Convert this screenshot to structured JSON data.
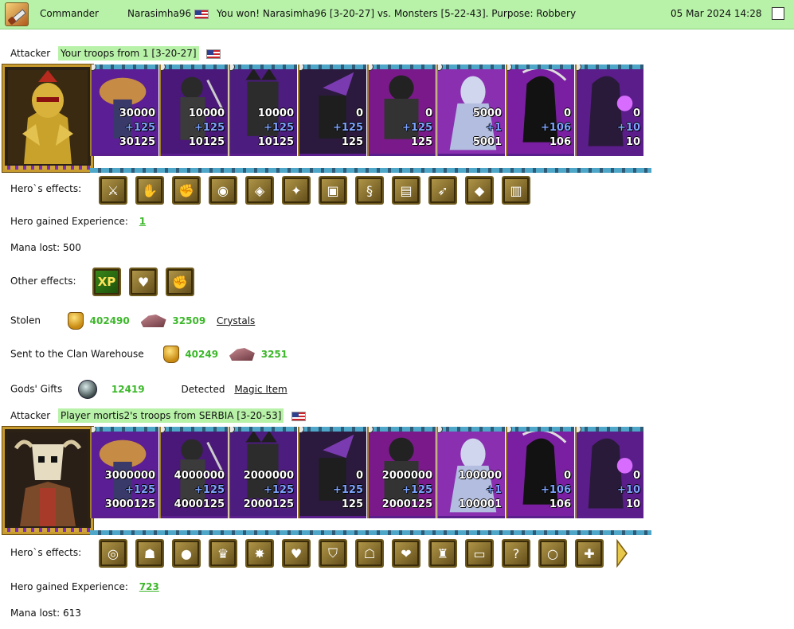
{
  "header": {
    "icon": "battle-report-icon",
    "role": "Commander",
    "player": "Narasimha96",
    "message": "You won! Narasimha96 [3-20-27] vs. Monsters [5-22-43]. Purpose: Robbery",
    "datetime": "05 Mar 2024 14:28",
    "bg_color": "#b8f2a8"
  },
  "attacker1": {
    "label": "Attacker",
    "troops": "Your troops from 1 [3-20-27]",
    "units": [
      {
        "n1": "30000",
        "n2": "+125",
        "n3": "30125"
      },
      {
        "n1": "10000",
        "n2": "+125",
        "n3": "10125"
      },
      {
        "n1": "10000",
        "n2": "+125",
        "n3": "10125"
      },
      {
        "n1": "0",
        "n2": "+125",
        "n3": "125"
      },
      {
        "n1": "0",
        "n2": "+125",
        "n3": "125"
      },
      {
        "n1": "5000",
        "n2": "+1",
        "n3": "5001"
      },
      {
        "n1": "0",
        "n2": "+106",
        "n3": "106"
      },
      {
        "n1": "0",
        "n2": "+10",
        "n3": "10"
      }
    ],
    "hero_effects_label": "Hero`s effects:",
    "hero_effects": [
      "sword-icon",
      "handshake-icon",
      "hand-icon",
      "pouch-icon",
      "shield-leaf-icon",
      "claw-icon",
      "armor-icon",
      "amulet-icon",
      "chest-icon",
      "bow-icon",
      "gem-bracer-icon",
      "vest-icon"
    ],
    "exp_label": "Hero gained Experience:",
    "exp_value": "1",
    "mana_label": "Mana lost:",
    "mana_value": "500",
    "other_effects_label": "Other effects:",
    "other_effects": [
      "XP",
      "heart-sword-icon",
      "fist-sword-icon"
    ],
    "stolen_label": "Stolen",
    "stolen_gold": "402490",
    "stolen_crystals": "32509",
    "stolen_link": "Crystals",
    "clan_label": "Sent to the Clan Warehouse",
    "clan_gold": "40249",
    "clan_crystals": "3251",
    "gods_label": "Gods' Gifts",
    "gods_value": "12419",
    "detected_label": "Detected",
    "detected_link": "Magic Item"
  },
  "attacker2": {
    "label": "Attacker",
    "troops": "Player mortis2's troops from SERBIA [3-20-53]",
    "units": [
      {
        "n1": "3000000",
        "n2": "+125",
        "n3": "3000125"
      },
      {
        "n1": "4000000",
        "n2": "+125",
        "n3": "4000125"
      },
      {
        "n1": "2000000",
        "n2": "+125",
        "n3": "2000125"
      },
      {
        "n1": "0",
        "n2": "+125",
        "n3": "125"
      },
      {
        "n1": "2000000",
        "n2": "+125",
        "n3": "2000125"
      },
      {
        "n1": "100000",
        "n2": "+1",
        "n3": "100001"
      },
      {
        "n1": "0",
        "n2": "+106",
        "n3": "106"
      },
      {
        "n1": "0",
        "n2": "+10",
        "n3": "10"
      }
    ],
    "hero_effects_label": "Hero`s effects:",
    "hero_effects": [
      "ring-icon",
      "helmet-icon",
      "orb-icon",
      "crown-icon",
      "treasure-icon",
      "heart-icon",
      "shield-icon",
      "helm-icon",
      "heart-wing-icon",
      "totem-icon",
      "belt-icon",
      "question-icon",
      "bracelet-icon",
      "cross-sword-icon"
    ],
    "exp_label": "Hero gained Experience:",
    "exp_value": "723",
    "mana_label": "Mana lost:",
    "mana_value": "613"
  }
}
